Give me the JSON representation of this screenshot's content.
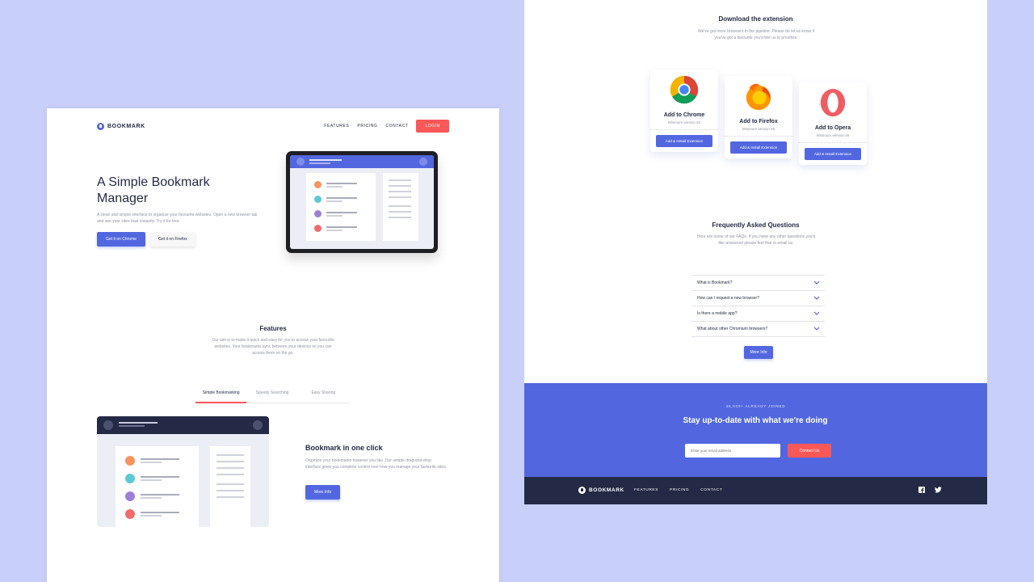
{
  "left_page": {
    "brand": "BOOKMARK",
    "nav": {
      "features": "FEATURES",
      "pricing": "PRICING",
      "contact": "CONTACT",
      "login": "LOGIN"
    },
    "hero": {
      "title": "A Simple Bookmark Manager",
      "text": "A clean and simple interface to organize your favourite websites. Open a new browser tab and see your sites load instantly. Try it for free.",
      "chrome_button": "Get it on Chrome",
      "firefox_button": "Get it on Firefox"
    },
    "features": {
      "title": "Features",
      "text": "Our aim is to make it quick and easy for you to access your favourite websites. Your bookmarks sync between your devices so you can access them on the go.",
      "tabs": [
        "Simple Bookmarking",
        "Speedy Searching",
        "Easy Sharing"
      ],
      "active_tab": "Simple Bookmarking",
      "heading": "Bookmark in one click",
      "paragraph": "Organize your bookmarks however you like. Our simple drag-and-drop interface gives you complete control over how you manage your favourite sites.",
      "button": "More Info"
    }
  },
  "right_page": {
    "download": {
      "title": "Download the extension",
      "text": "We've got more browsers in the pipeline. Please do let us know if you've got a favourite you'd like us to prioritize.",
      "cards": [
        {
          "title": "Add to Chrome",
          "sub": "Minimum version 62",
          "button": "Add & Install Extension",
          "icon": "chrome-logo"
        },
        {
          "title": "Add to Firefox",
          "sub": "Minimum version 55",
          "button": "Add & Install Extension",
          "icon": "firefox-logo"
        },
        {
          "title": "Add to Opera",
          "sub": "Minimum version 46",
          "button": "Add & Install Extension",
          "icon": "opera-logo"
        }
      ]
    },
    "faq": {
      "title": "Frequently Asked Questions",
      "text": "Here are some of our FAQs. If you have any other questions you'd like answered please feel free to email us.",
      "items": [
        "What is Bookmark?",
        "How can I request a new browser?",
        "Is there a mobile app?",
        "What about other Chromium browsers?"
      ],
      "button": "More Info"
    },
    "cta": {
      "small": "35,000+ ALREADY JOINED",
      "title": "Stay up-to-date with what we're doing",
      "placeholder": "Enter your email address",
      "button": "Contact Us"
    },
    "footer": {
      "brand": "BOOKMARK",
      "features": "FEATURES",
      "pricing": "PRICING",
      "contact": "CONTACT",
      "icons": [
        "facebook-icon",
        "twitter-icon"
      ]
    }
  },
  "colors": {
    "background": "#c8d0fa",
    "primary_blue": "#5267df",
    "soft_red": "#fa5757",
    "dark_navy": "#242a45",
    "grayish_blue": "#9194a2"
  }
}
